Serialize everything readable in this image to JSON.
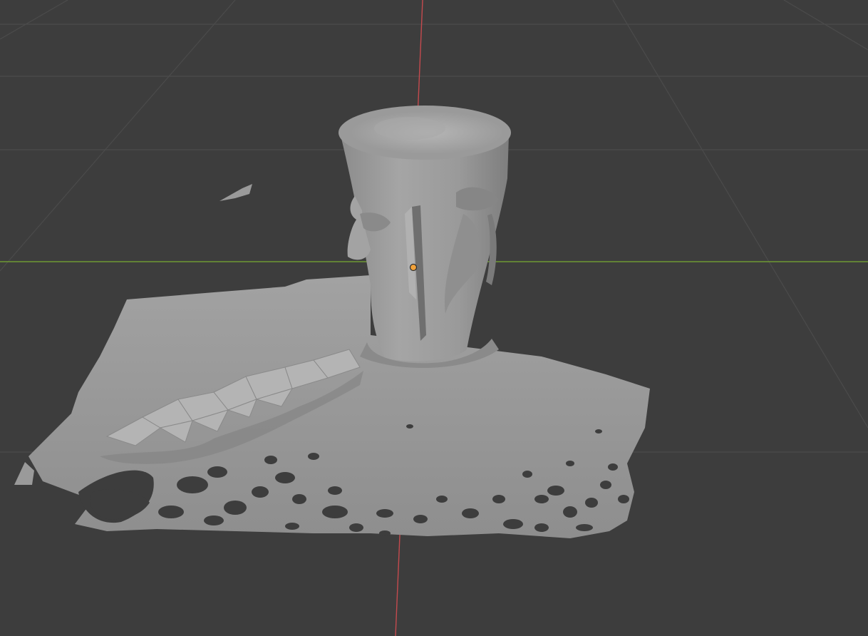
{
  "viewport": {
    "mode": "3d-viewport",
    "background": "#3d3d3d",
    "grid_color": "#4a4a4a",
    "x_axis_color": "#c8484c",
    "y_axis_color": "#7aa53a",
    "object_color": "#8e8e8e",
    "origin_color": "#f2a23a"
  },
  "scene": {
    "object": "scanned-mesh-face-cup",
    "has_origin_marker": true
  }
}
